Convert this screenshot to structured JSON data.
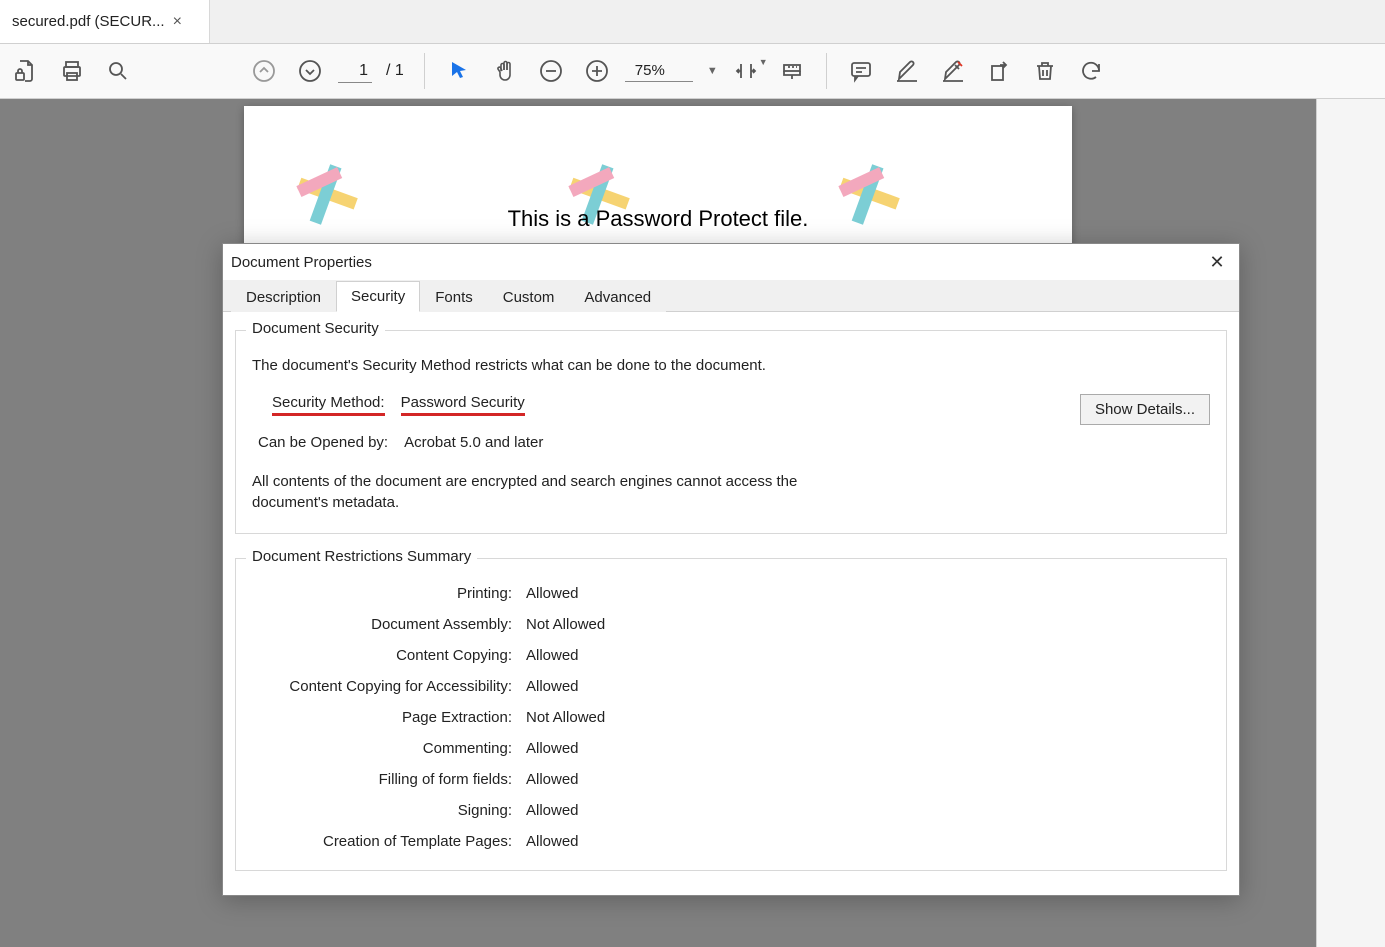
{
  "tab": {
    "title": "secured.pdf (SECUR..."
  },
  "toolbar": {
    "page_current": "1",
    "page_total": "/ 1",
    "zoom": "75%"
  },
  "page": {
    "content_text": "This is a Password Protect file."
  },
  "dialog": {
    "title": "Document Properties",
    "tabs": {
      "description": "Description",
      "security": "Security",
      "fonts": "Fonts",
      "custom": "Custom",
      "advanced": "Advanced"
    },
    "security": {
      "fieldset_title": "Document Security",
      "description": "The document's Security Method restricts what can be done to the document.",
      "method_label": "Security Method:",
      "method_value": "Password Security",
      "opened_label": "Can be Opened by:",
      "opened_value": "Acrobat 5.0 and later",
      "note": "All contents of the document are encrypted and search engines cannot access the document's metadata.",
      "show_details_btn": "Show Details..."
    },
    "restrictions": {
      "fieldset_title": "Document Restrictions Summary",
      "rows": [
        {
          "label": "Printing:",
          "value": "Allowed"
        },
        {
          "label": "Document Assembly:",
          "value": "Not Allowed"
        },
        {
          "label": "Content Copying:",
          "value": "Allowed"
        },
        {
          "label": "Content Copying for Accessibility:",
          "value": "Allowed"
        },
        {
          "label": "Page Extraction:",
          "value": "Not Allowed"
        },
        {
          "label": "Commenting:",
          "value": "Allowed"
        },
        {
          "label": "Filling of form fields:",
          "value": "Allowed"
        },
        {
          "label": "Signing:",
          "value": "Allowed"
        },
        {
          "label": "Creation of Template Pages:",
          "value": "Allowed"
        }
      ]
    }
  }
}
